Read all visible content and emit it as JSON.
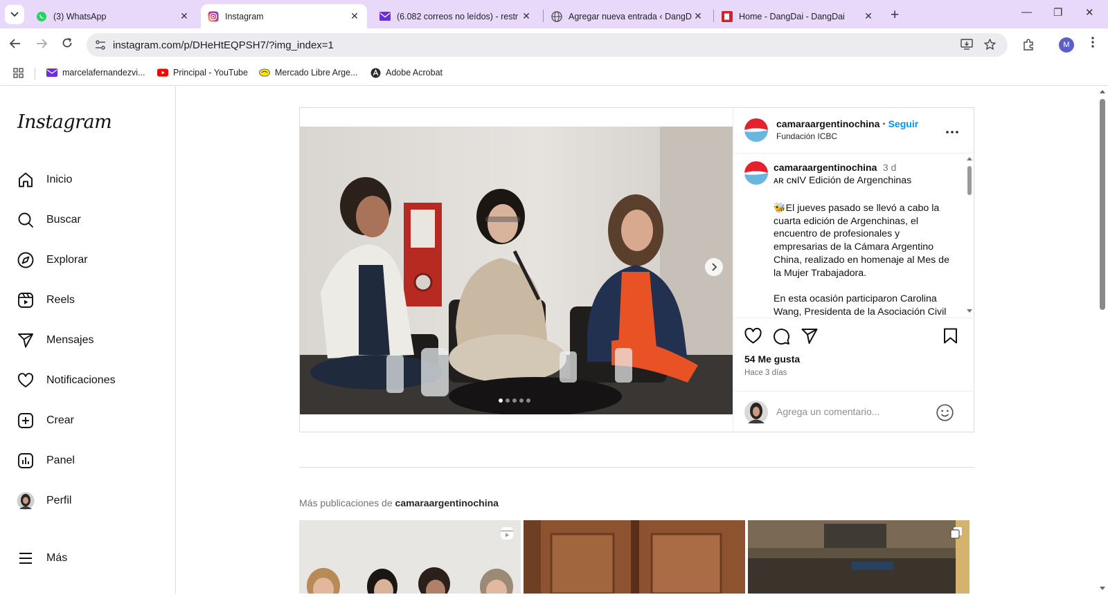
{
  "browser": {
    "tabs": [
      {
        "title": "(3) WhatsApp",
        "icon": "whatsapp-icon"
      },
      {
        "title": "Instagram",
        "icon": "instagram-icon"
      },
      {
        "title": "(6.082 correos no leídos) - restr",
        "icon": "mail-icon"
      },
      {
        "title": "Agregar nueva entrada ‹ DangD",
        "icon": "globe-icon"
      },
      {
        "title": "Home - DangDai - DangDai",
        "icon": "dangdai-icon"
      }
    ],
    "url": "instagram.com/p/DHeHtEQPSH7/?img_index=1",
    "account_initial": "M",
    "bookmarks": [
      {
        "label": "marcelafernandezvi...",
        "icon": "mail-icon"
      },
      {
        "label": "Principal - YouTube",
        "icon": "youtube-icon"
      },
      {
        "label": "Mercado Libre Arge...",
        "icon": "mercadolibre-icon"
      },
      {
        "label": "Adobe Acrobat",
        "icon": "acrobat-icon"
      }
    ]
  },
  "sidebar": {
    "logo": "Instagram",
    "items": [
      {
        "label": "Inicio",
        "icon": "home-icon"
      },
      {
        "label": "Buscar",
        "icon": "search-icon"
      },
      {
        "label": "Explorar",
        "icon": "compass-icon"
      },
      {
        "label": "Reels",
        "icon": "reels-icon"
      },
      {
        "label": "Mensajes",
        "icon": "send-icon"
      },
      {
        "label": "Notificaciones",
        "icon": "heart-icon"
      },
      {
        "label": "Crear",
        "icon": "plus-square-icon"
      },
      {
        "label": "Panel",
        "icon": "chart-icon"
      },
      {
        "label": "Perfil",
        "icon": "profile-avatar"
      },
      {
        "label": "Más",
        "icon": "menu-icon"
      }
    ]
  },
  "post": {
    "author": "camaraargentinochina",
    "follow": "Seguir",
    "separator": "•",
    "location": "Fundación ICBC",
    "caption_author": "camaraargentinochina",
    "caption_age": "3 d",
    "caption_lines": [
      "ᴀʀ ᴄɴIV Edición de Argenchinas",
      "",
      "🐝El jueves pasado se llevó a cabo la cuarta edición de Argenchinas, el encuentro de profesionales y empresarias de la Cámara Argentino China, realizado en homenaje al Mes de la Mujer Trabajadora.",
      "",
      "En esta ocasión participaron Carolina Wang, Presidenta de la Asociación Civil"
    ],
    "likes": "54 Me gusta",
    "posted_ago": "Hace 3 días",
    "comment_placeholder": "Agrega un comentario...",
    "carousel_count": 5,
    "carousel_active": 0
  },
  "more_posts": {
    "prefix": "Más publicaciones de",
    "author": "camaraargentinochina"
  },
  "colors": {
    "tabbar": "#e8d9fb",
    "link_blue": "#0095f6",
    "border": "#dbdbdb"
  }
}
